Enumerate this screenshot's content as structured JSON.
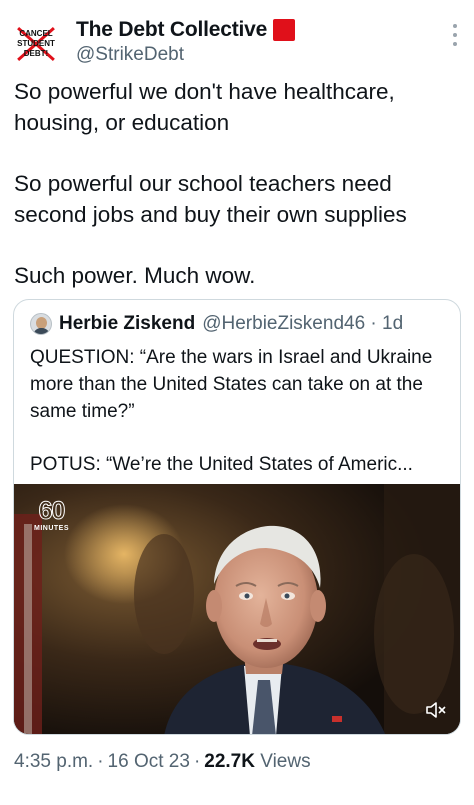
{
  "author": {
    "display_name": "The Debt Collective",
    "handle": "@StrikeDebt",
    "avatar_text": "CANCEL STUDENT DEBT!",
    "flag_color": "#e0101a"
  },
  "tweet": {
    "paragraphs": [
      "So powerful we don't have healthcare, housing, or education",
      "So powerful our school teachers need second jobs and buy their own supplies",
      "Such power. Much wow."
    ]
  },
  "quote": {
    "author_name": "Herbie Ziskend",
    "handle": "@HerbieZiskend46",
    "time": "1d",
    "text_question": "QUESTION: “Are the wars in Israel and Ukraine more than the United States can take on at the same time?”",
    "text_potus": "POTUS: “We’re the United States of Americ...",
    "video": {
      "logo_number": "60",
      "logo_sub": "MINUTES",
      "mute_icon": "speaker-muted-icon"
    }
  },
  "meta": {
    "time": "4:35 p.m.",
    "date": "16 Oct 23",
    "views_count": "22.7K",
    "views_label": "Views"
  },
  "colors": {
    "text": "#0f1419",
    "secondary": "#536471",
    "border": "#cfd9de"
  }
}
